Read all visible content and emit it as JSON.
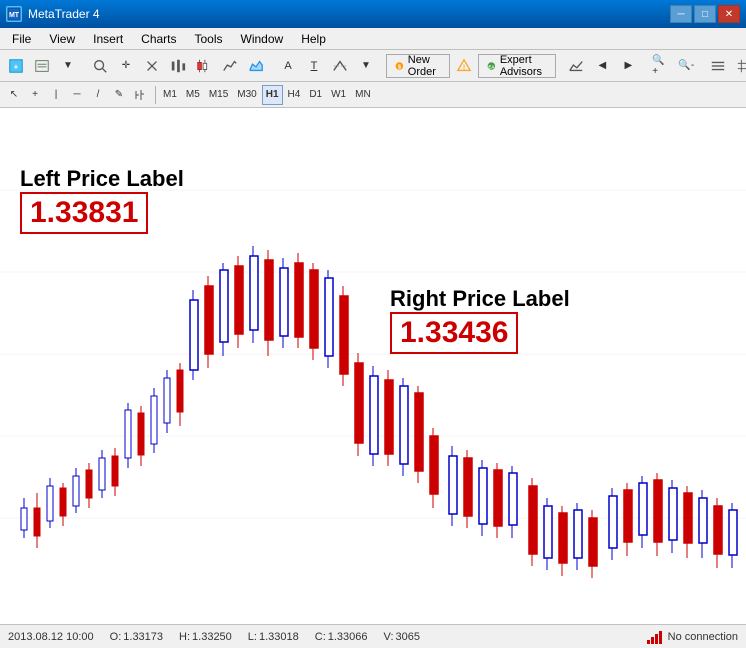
{
  "window": {
    "title": "MetaTrader 4",
    "titlebar_icon": "MT4"
  },
  "menu": {
    "items": [
      "File",
      "View",
      "Insert",
      "Charts",
      "Tools",
      "Window",
      "Help"
    ]
  },
  "toolbar": {
    "new_order_label": "New Order",
    "expert_advisors_label": "Expert Advisors"
  },
  "timeframes": {
    "items": [
      "M1",
      "M5",
      "M15",
      "M30",
      "H1",
      "H4",
      "D1",
      "W1",
      "MN"
    ],
    "active": "H1"
  },
  "chart": {
    "left_price_label_title": "Left Price Label",
    "left_price_value": "1.33831",
    "right_price_label_title": "Right Price Label",
    "right_price_value": "1.33436"
  },
  "status_bar": {
    "datetime": "2013.08.12 10:00",
    "open_label": "O:",
    "open_value": "1.33173",
    "high_label": "H:",
    "high_value": "1.33250",
    "low_label": "L:",
    "low_value": "1.33018",
    "close_label": "C:",
    "close_value": "1.33066",
    "volume_label": "V:",
    "volume_value": "3065",
    "connection_status": "No connection"
  },
  "colors": {
    "bull_candle": "#0000cc",
    "bear_candle": "#cc0000",
    "price_label_border": "#cc0000",
    "price_label_text": "#cc0000"
  }
}
